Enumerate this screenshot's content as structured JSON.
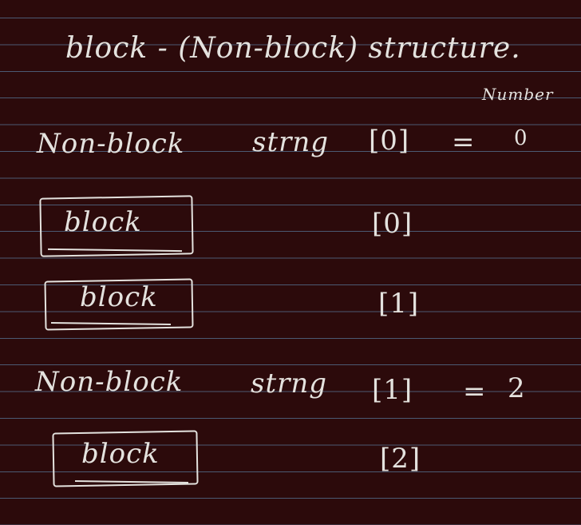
{
  "title": "block - (Non-block) structure.",
  "header_number": "Number",
  "rows": [
    {
      "kind": "non-block",
      "label": "Non-block",
      "sub": "strng",
      "index": "[0]",
      "eq": "=",
      "count": "0"
    },
    {
      "kind": "block",
      "label": "block",
      "index": "[0]"
    },
    {
      "kind": "block",
      "label": "block",
      "index": "[1]"
    },
    {
      "kind": "non-block",
      "label": "Non-block",
      "sub": "strng",
      "index": "[1]",
      "eq": "=",
      "count": "2"
    },
    {
      "kind": "block",
      "label": "block",
      "index": "[2]"
    }
  ]
}
